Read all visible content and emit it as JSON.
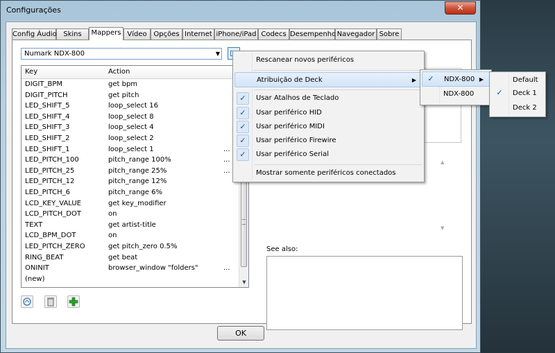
{
  "window": {
    "title": "Configurações",
    "close_label": "✕"
  },
  "tabs": [
    {
      "label": "Config Áudio"
    },
    {
      "label": "Skins"
    },
    {
      "label": "Mappers"
    },
    {
      "label": "Vídeo"
    },
    {
      "label": "Opções"
    },
    {
      "label": "Internet"
    },
    {
      "label": "iPhone/iPad"
    },
    {
      "label": "Codecs"
    },
    {
      "label": "Desempenho"
    },
    {
      "label": "Navegador"
    },
    {
      "label": "Sobre"
    }
  ],
  "active_tab": "Mappers",
  "device_select": {
    "value": "Numark NDX-800"
  },
  "mapping_list": {
    "columns": {
      "key": "Key",
      "action": "Action"
    },
    "rows": [
      {
        "key": "DIGIT_BPM",
        "action": "get bpm",
        "dots": ""
      },
      {
        "key": "DIGIT_PITCH",
        "action": "get pitch",
        "dots": ""
      },
      {
        "key": "LED_SHIFT_5",
        "action": "loop_select 16",
        "dots": ""
      },
      {
        "key": "LED_SHIFT_4",
        "action": "loop_select 8",
        "dots": ""
      },
      {
        "key": "LED_SHIFT_3",
        "action": "loop_select 4",
        "dots": ""
      },
      {
        "key": "LED_SHIFT_2",
        "action": "loop_select 2",
        "dots": ""
      },
      {
        "key": "LED_SHIFT_1",
        "action": "loop_select 1",
        "dots": "..."
      },
      {
        "key": "LED_PITCH_100",
        "action": "pitch_range 100%",
        "dots": "..."
      },
      {
        "key": "LED_PITCH_25",
        "action": "pitch_range 25%",
        "dots": "..."
      },
      {
        "key": "LED_PITCH_12",
        "action": "pitch_range 12%",
        "dots": ""
      },
      {
        "key": "LED_PITCH_6",
        "action": "pitch_range 6%",
        "dots": ""
      },
      {
        "key": "LCD_KEY_VALUE",
        "action": "get key_modifier",
        "dots": ""
      },
      {
        "key": "LCD_PITCH_DOT",
        "action": "on",
        "dots": ""
      },
      {
        "key": "TEXT",
        "action": "get artist-title",
        "dots": ""
      },
      {
        "key": "LCD_BPM_DOT",
        "action": "on",
        "dots": ""
      },
      {
        "key": "LED_PITCH_ZERO",
        "action": "get pitch_zero 0.5%",
        "dots": ""
      },
      {
        "key": "RING_BEAT",
        "action": "get beat",
        "dots": ""
      },
      {
        "key": "ONINIT",
        "action": "browser_window \"folders\"",
        "dots": "..."
      },
      {
        "key": "(new)",
        "action": "",
        "dots": ""
      }
    ]
  },
  "see_also": {
    "label": "See also:"
  },
  "ok_button": {
    "label": "OK"
  },
  "context_menu": {
    "items": [
      {
        "label": "Rescanear novos periféricos",
        "checked": false
      },
      {
        "label": "Atribuição de Deck",
        "checked": false,
        "submenu_arrow": "▶"
      },
      {
        "label": "Usar Atalhos de Teclado",
        "checked": true
      },
      {
        "label": "Usar periférico HID",
        "checked": true
      },
      {
        "label": "Usar periférico MIDI",
        "checked": true
      },
      {
        "label": "Usar periférico Firewire",
        "checked": true
      },
      {
        "label": "Usar periférico Serial",
        "checked": true
      },
      {
        "label": "Mostrar somente periféricos conectados",
        "checked": false
      }
    ]
  },
  "submenu_devices": {
    "items": [
      {
        "label": "NDX-800",
        "checked": true,
        "arrow": "▶"
      },
      {
        "label": "NDX-800",
        "checked": false
      }
    ]
  },
  "submenu_decks": {
    "items": [
      {
        "label": "Default",
        "checked": false
      },
      {
        "label": "Deck 1",
        "checked": true
      },
      {
        "label": "Deck 2",
        "checked": false
      }
    ]
  },
  "check_glyph": "✓",
  "combo_arrow": "▼",
  "scroll_up": "▲",
  "scroll_down": "▼"
}
